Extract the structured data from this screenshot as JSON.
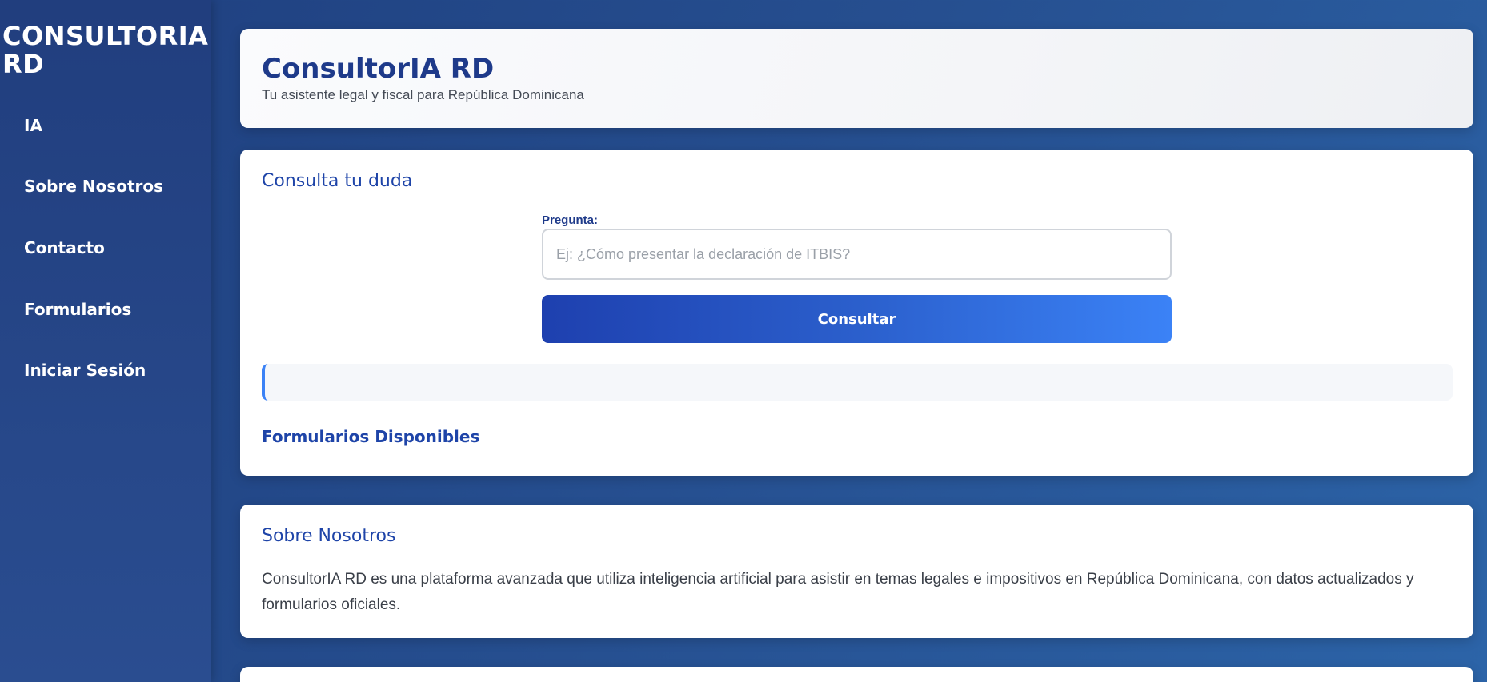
{
  "sidebar": {
    "brand": "CONSULTORIA RD",
    "items": [
      {
        "label": "IA"
      },
      {
        "label": "Sobre Nosotros"
      },
      {
        "label": "Contacto"
      },
      {
        "label": "Formularios"
      },
      {
        "label": "Iniciar Sesión"
      }
    ]
  },
  "header": {
    "title": "ConsultorIA RD",
    "subtitle": "Tu asistente legal y fiscal para República Dominicana"
  },
  "consulta": {
    "title": "Consulta tu duda",
    "question_label": "Pregunta:",
    "question_value": "",
    "question_placeholder": "Ej: ¿Cómo presentar la declaración de ITBIS?",
    "submit_label": "Consultar",
    "response_text": "",
    "forms_link": "Formularios Disponibles"
  },
  "about": {
    "title": "Sobre Nosotros",
    "text": "ConsultorIA RD es una plataforma avanzada que utiliza inteligencia artificial para asistir en temas legales e impositivos en República Dominicana, con datos actualizados y formularios oficiales."
  },
  "colors": {
    "primary": "#1e3a8a",
    "accent": "#3b82f6",
    "background": "#264f90"
  }
}
